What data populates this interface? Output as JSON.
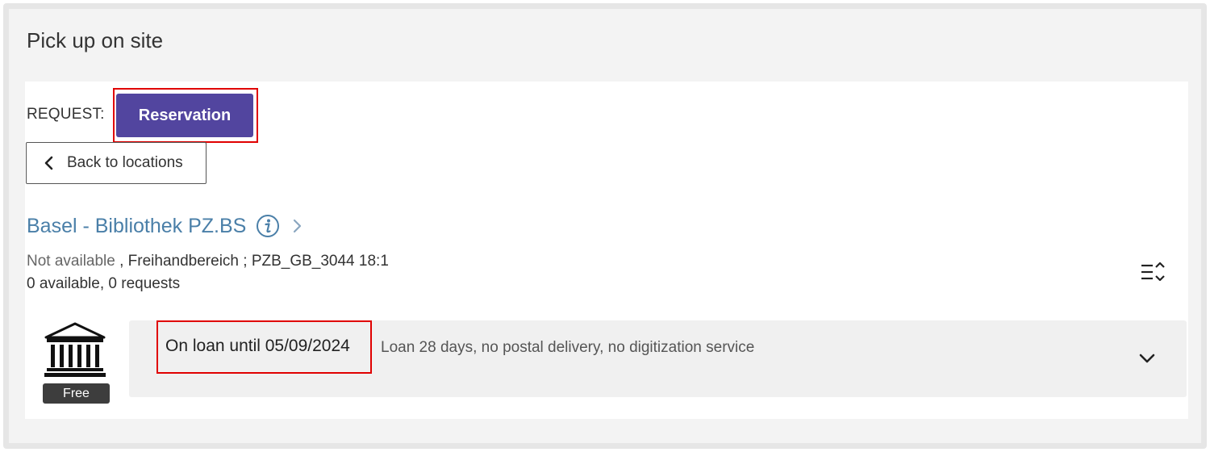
{
  "section": {
    "title": "Pick up on site"
  },
  "request": {
    "label": "REQUEST:",
    "reservation_button": "Reservation"
  },
  "navigation": {
    "back_label": "Back to locations"
  },
  "location": {
    "name": "Basel - Bibliothek PZ.BS",
    "availability_status": "Not available",
    "availability_details": " , Freihandbereich ; PZB_GB_3044 18:1",
    "counts": "0 available, 0 requests"
  },
  "item": {
    "badge": "Free",
    "loan_status": "On loan until 05/09/2024",
    "policy": "Loan 28 days, no postal delivery, no digitization service"
  },
  "icons": {
    "back": "chevron-left-icon",
    "info": "info-icon",
    "location_arrow": "chevron-right-icon",
    "sort": "sort-icon",
    "library": "library-building-icon",
    "expand": "chevron-down-icon"
  },
  "colors": {
    "primary_button": "#52459f",
    "link": "#4a7fa8",
    "highlight": "#e00000",
    "badge": "#3d3d3d"
  }
}
